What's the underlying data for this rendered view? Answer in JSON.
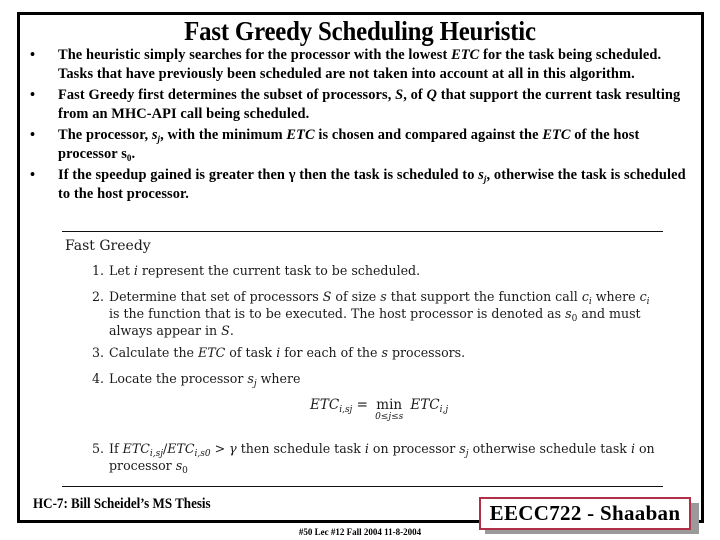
{
  "slide": {
    "title": "Fast Greedy Scheduling Heuristic",
    "bullets": [
      {
        "parts": [
          {
            "t": "The heuristic simply searches for the processor with the lowest "
          },
          {
            "t": "ETC",
            "italic": true
          },
          {
            "t": " for the task being scheduled.  Tasks that have previously been scheduled are not taken into account at all in this algorithm."
          }
        ]
      },
      {
        "parts": [
          {
            "t": "Fast Greedy first determines the subset of processors, "
          },
          {
            "t": "S",
            "italic": true
          },
          {
            "t": ", of "
          },
          {
            "t": "Q",
            "italic": true
          },
          {
            "t": " that support the current  task resulting from an MHC-API  call being scheduled."
          }
        ]
      },
      {
        "parts": [
          {
            "t": "The processor, "
          },
          {
            "t": "s",
            "italic": true
          },
          {
            "t": "j",
            "sub": true,
            "italic": true
          },
          {
            "t": ", with the minimum "
          },
          {
            "t": "ETC",
            "italic": true
          },
          {
            "t": " is chosen and compared against the "
          },
          {
            "t": "ETC",
            "italic": true
          },
          {
            "t": " of the host processor s"
          },
          {
            "t": "0",
            "sub": true
          },
          {
            "t": "."
          }
        ]
      },
      {
        "parts": [
          {
            "t": "If the speedup gained is greater then "
          },
          {
            "t": "γ"
          },
          {
            "t": " then the task is scheduled to "
          },
          {
            "t": "s",
            "italic": true
          },
          {
            "t": "j",
            "sub": true,
            "italic": true
          },
          {
            "t": ", otherwise the task is scheduled to the host processor."
          }
        ]
      }
    ],
    "bullet_glyph": "•"
  },
  "algorithm": {
    "title": "Fast Greedy",
    "steps": [
      {
        "num": "1.",
        "html_parts": [
          {
            "t": "Let "
          },
          {
            "t": "i",
            "italic": true
          },
          {
            "t": " represent the current task to be scheduled."
          }
        ]
      },
      {
        "num": "2.",
        "html_parts": [
          {
            "t": "Determine that set of processors "
          },
          {
            "t": "S",
            "italic": true
          },
          {
            "t": " of size "
          },
          {
            "t": "s",
            "italic": true
          },
          {
            "t": " that support the function call "
          },
          {
            "t": "c",
            "italic": true
          },
          {
            "t": "i",
            "sub": true,
            "italic": true
          },
          {
            "t": " where "
          },
          {
            "t": "c",
            "italic": true
          },
          {
            "t": "i",
            "sub": true,
            "italic": true
          },
          {
            "t": " is the function that is to be executed. The host processor is denoted as "
          },
          {
            "t": "s",
            "italic": true
          },
          {
            "t": "0",
            "sub": true
          },
          {
            "t": " and must always appear in "
          },
          {
            "t": "S",
            "italic": true
          },
          {
            "t": "."
          }
        ]
      },
      {
        "num": "3.",
        "html_parts": [
          {
            "t": "Calculate the "
          },
          {
            "t": "ETC",
            "italic": true
          },
          {
            "t": " of task "
          },
          {
            "t": "i",
            "italic": true
          },
          {
            "t": " for each of the "
          },
          {
            "t": "s",
            "italic": true
          },
          {
            "t": " processors."
          }
        ]
      },
      {
        "num": "4.",
        "html_parts": [
          {
            "t": "Locate the processor "
          },
          {
            "t": "s",
            "italic": true
          },
          {
            "t": "j",
            "sub": true,
            "italic": true
          },
          {
            "t": " where"
          }
        ]
      },
      {
        "num": "5.",
        "html_parts": [
          {
            "t": "If "
          },
          {
            "t": "ETC",
            "italic": true
          },
          {
            "t": "i,s_j",
            "sub": true,
            "italic": true
          },
          {
            "t": "/"
          },
          {
            "t": "ETC",
            "italic": true
          },
          {
            "t": "i,s_0",
            "sub": true,
            "italic": true
          },
          {
            "t": " > "
          },
          {
            "t": "γ",
            "italic": true
          },
          {
            "t": " then schedule task "
          },
          {
            "t": "i",
            "italic": true
          },
          {
            "t": " on processor "
          },
          {
            "t": "s",
            "italic": true
          },
          {
            "t": "j",
            "sub": true,
            "italic": true
          },
          {
            "t": " otherwise schedule task "
          },
          {
            "t": "i",
            "italic": true
          },
          {
            "t": " on processor "
          },
          {
            "t": "s",
            "italic": true
          },
          {
            "t": "0",
            "sub": true
          }
        ]
      }
    ],
    "formula": {
      "lhs": "ETC",
      "lhs_sub": "i,s_j",
      "equals": "=",
      "op": "min",
      "op_under": "0≤j≤s",
      "rhs": "ETC",
      "rhs_sub": "i,j"
    }
  },
  "footer": {
    "left": "HC-7: Bill Scheidel’s MS Thesis",
    "center": "#50   Lec #12   Fall 2004  11-8-2004",
    "badge": "EECC722 - Shaaban"
  },
  "colors": {
    "badge_border": "#b03048",
    "badge_shadow": "#9a9a9a",
    "frame": "#000000"
  }
}
